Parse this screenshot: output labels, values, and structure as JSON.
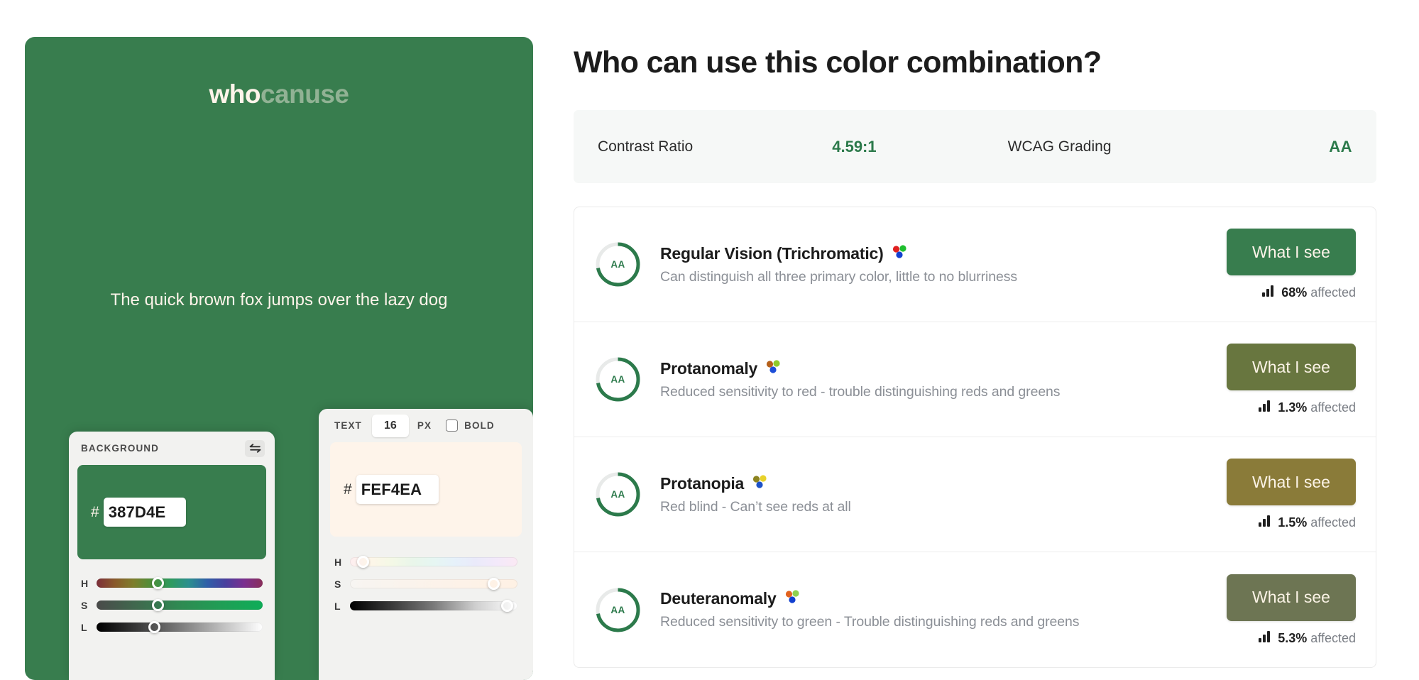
{
  "brand": {
    "logo_primary": "who",
    "logo_secondary": "canuse"
  },
  "preview": {
    "sample_text": "The quick brown fox jumps over the lazy dog",
    "background_color": "#387D4E",
    "text_color": "#FEF4EA"
  },
  "background_picker": {
    "label": "BACKGROUND",
    "swap_icon": "swap-horizontal-icon",
    "hash": "#",
    "hex_value": "387D4E",
    "sliders": [
      {
        "key": "H",
        "pos_pct": 37
      },
      {
        "key": "S",
        "pos_pct": 37
      },
      {
        "key": "L",
        "pos_pct": 35
      }
    ]
  },
  "text_picker": {
    "label": "TEXT",
    "font_size": "16",
    "unit": "PX",
    "bold_label": "BOLD",
    "bold_checked": false,
    "hash": "#",
    "hex_value": "FEF4EA",
    "sliders": [
      {
        "key": "H",
        "pos_pct": 8
      },
      {
        "key": "S",
        "pos_pct": 86
      },
      {
        "key": "L",
        "pos_pct": 94
      }
    ]
  },
  "header": {
    "title": "Who can use this color combination?"
  },
  "summary": {
    "contrast_label": "Contrast Ratio",
    "contrast_value": "4.59:1",
    "wcag_label": "WCAG Grading",
    "wcag_value": "AA",
    "accent_color": "#2C7A4B"
  },
  "vision_rows": [
    {
      "badge": "AA",
      "ring_pct": 72,
      "name": "Regular Vision (Trichromatic)",
      "description": "Can distinguish all three primary color, little to no blurriness",
      "dots": [
        "#E02020",
        "#1FBF2F",
        "#1240D0"
      ],
      "button_label": "What I see",
      "button_bg": "#387D4E",
      "button_fg": "#FEF4EA",
      "affected_pct": "68%",
      "affected_suffix": "affected",
      "chart_icon": "bar-chart-icon"
    },
    {
      "badge": "AA",
      "ring_pct": 72,
      "name": "Protanomaly",
      "description": "Reduced sensitivity to red - trouble distinguishing reds and greens",
      "dots": [
        "#B5601A",
        "#8FCB2A",
        "#1D4ED8"
      ],
      "button_label": "What I see",
      "button_bg": "#68763F",
      "button_fg": "#FBF3E6",
      "affected_pct": "1.3%",
      "affected_suffix": "affected",
      "chart_icon": "bar-chart-icon"
    },
    {
      "badge": "AA",
      "ring_pct": 72,
      "name": "Protanopia",
      "description": "Red blind - Can’t see reds at all",
      "dots": [
        "#8D8420",
        "#E8D22A",
        "#1D52C8"
      ],
      "button_label": "What I see",
      "button_bg": "#8A7B39",
      "button_fg": "#FBF3E6",
      "affected_pct": "1.5%",
      "affected_suffix": "affected",
      "chart_icon": "bar-chart-icon"
    },
    {
      "badge": "AA",
      "ring_pct": 72,
      "name": "Deuteranomaly",
      "description": "Reduced sensitivity to green - Trouble distinguishing reds and greens",
      "dots": [
        "#E2621E",
        "#8FD14F",
        "#1240D0"
      ],
      "button_label": "What I see",
      "button_bg": "#6D7553",
      "button_fg": "#FBF3E6",
      "affected_pct": "5.3%",
      "affected_suffix": "affected",
      "chart_icon": "bar-chart-icon"
    }
  ]
}
